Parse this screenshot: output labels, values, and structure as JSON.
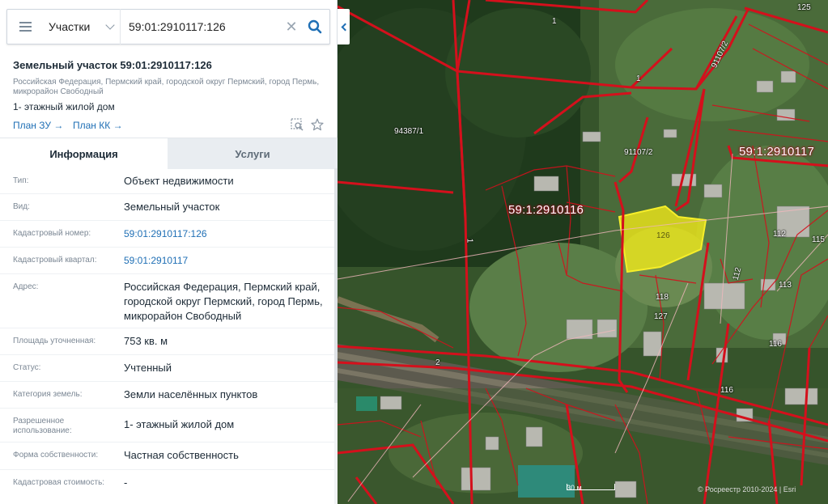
{
  "search": {
    "type_label": "Участки",
    "query": "59:01:2910117:126"
  },
  "object": {
    "title": "Земельный участок 59:01:2910117:126",
    "address": "Российская Федерация, Пермский край, городской округ Пермский, город Пермь, микрорайон Свободный",
    "usage": "1- этажный жилой дом",
    "plan_zu": "План ЗУ →",
    "plan_kk": "План КК →"
  },
  "tabs": {
    "info": "Информация",
    "services": "Услуги"
  },
  "info": {
    "type_label": "Тип:",
    "type_value": "Объект недвижимости",
    "kind_label": "Вид:",
    "kind_value": "Земельный участок",
    "cad_num_label": "Кадастровый номер:",
    "cad_num_value": "59:01:2910117:126",
    "cad_quarter_label": "Кадастровый квартал:",
    "cad_quarter_value": "59:01:2910117",
    "address_label": "Адрес:",
    "address_value": "Российская Федерация, Пермский край, городской округ Пермский, город Пермь, микрорайон Свободный",
    "area_label": "Площадь уточненная:",
    "area_value": "753 кв. м",
    "status_label": "Статус:",
    "status_value": "Учтенный",
    "category_label": "Категория земель:",
    "category_value": "Земли населённых пунктов",
    "permitted_label": "Разрешенное использование:",
    "permitted_value": "1- этажный жилой дом",
    "ownership_label": "Форма собственности:",
    "ownership_value": "Частная собственность",
    "cost_label": "Кадастровая стоимость:",
    "cost_value": "-"
  },
  "map": {
    "quarter_1": "59:1:2910116",
    "quarter_2": "59:1:2910117",
    "plot_126": "126",
    "plot_118": "118",
    "plot_127": "127",
    "plot_112a": "112",
    "plot_112b": "112",
    "plot_113": "113",
    "plot_115": "115",
    "plot_116a": "116",
    "plot_116b": "116",
    "plot_125": "125",
    "lbl_1a": "1",
    "lbl_1b": "1",
    "lbl_1c": "1",
    "lbl_2": "2",
    "lbl_94387": "94387/1",
    "lbl_91107_2a": "91107/2",
    "lbl_91107_2b": "91107/2",
    "scale": "30 м",
    "copyright": "© Росреестр 2010-2024 | Esri"
  },
  "colors": {
    "accent": "#1f6fb5",
    "boundary": "#d4101c",
    "selected": "#f0e81a"
  }
}
